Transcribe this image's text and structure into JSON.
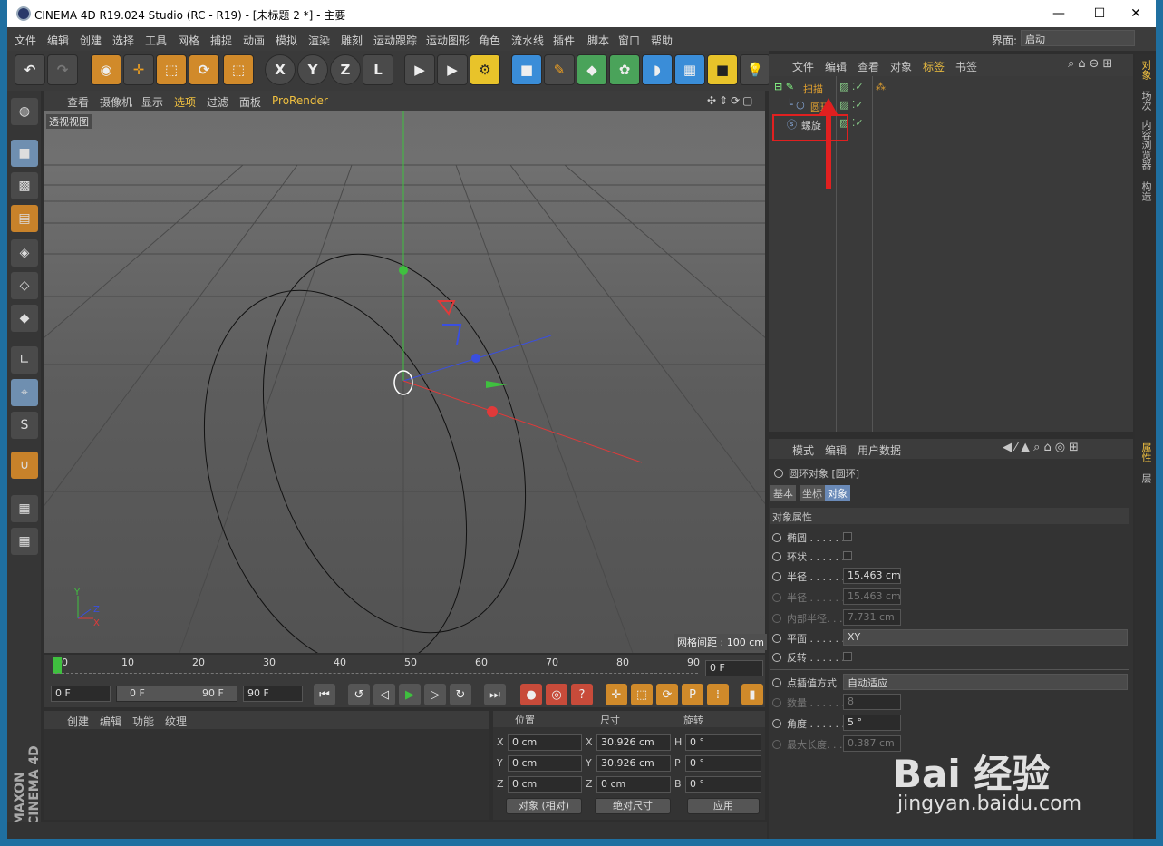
{
  "window": {
    "title": "CINEMA 4D R19.024 Studio (RC - R19) - [未标题 2 *] - 主要",
    "min": "—",
    "max": "☐",
    "close": "✕"
  },
  "menu": [
    "文件",
    "编辑",
    "创建",
    "选择",
    "工具",
    "网格",
    "捕捉",
    "动画",
    "模拟",
    "渲染",
    "雕刻",
    "运动跟踪",
    "运动图形",
    "角色",
    "流水线",
    "插件",
    "脚本",
    "窗口",
    "帮助"
  ],
  "layout": {
    "label": "界面:",
    "value": "启动"
  },
  "viewport_menu": [
    "查看",
    "摄像机",
    "显示",
    "选项",
    "过滤",
    "面板",
    "ProRender"
  ],
  "viewport": {
    "label": "透视视图",
    "grid_spacing": "网格间距 : 100 cm",
    "axis_y": "Y",
    "axis_z": "Z",
    "axis_x": "X"
  },
  "timeline": {
    "ticks": [
      "0",
      "10",
      "20",
      "30",
      "40",
      "50",
      "60",
      "70",
      "80",
      "90"
    ],
    "current_frame": "0 F"
  },
  "transport": {
    "start": "0 F",
    "range_start": "0 F",
    "range_end": "90 F",
    "end": "90 F"
  },
  "material_menu": [
    "创建",
    "编辑",
    "功能",
    "纹理"
  ],
  "coords": {
    "headers": [
      "位置",
      "尺寸",
      "旋转"
    ],
    "rows": [
      {
        "pl": "X",
        "pos": "0 cm",
        "sl": "X",
        "size": "30.926 cm",
        "rl": "H",
        "rot": "0 °"
      },
      {
        "pl": "Y",
        "pos": "0 cm",
        "sl": "Y",
        "size": "30.926 cm",
        "rl": "P",
        "rot": "0 °"
      },
      {
        "pl": "Z",
        "pos": "0 cm",
        "sl": "Z",
        "size": "0 cm",
        "rl": "B",
        "rot": "0 °"
      }
    ],
    "mode": "对象 (相对)",
    "size_mode": "绝对尺寸",
    "apply": "应用"
  },
  "object_manager": {
    "menu": [
      "文件",
      "编辑",
      "查看",
      "对象",
      "标签",
      "书签"
    ],
    "objects": [
      {
        "name": "扫描",
        "color": "#e0a030"
      },
      {
        "name": "圆环",
        "color": "#e0a030"
      },
      {
        "name": "螺旋",
        "color": "#c8c8c8"
      }
    ]
  },
  "attributes": {
    "menu": [
      "模式",
      "编辑",
      "用户数据"
    ],
    "title": "圆环对象 [圆环]",
    "tabs": [
      "基本",
      "坐标",
      "对象"
    ],
    "section": "对象属性",
    "rows": [
      {
        "label": "椭圆 . . . . . .",
        "type": "check"
      },
      {
        "label": "环状 . . . . . .",
        "type": "check"
      },
      {
        "label": "半径 . . . . . .",
        "value": "15.463 cm"
      },
      {
        "label": "半径 . . . . . .",
        "value": "15.463 cm",
        "dim": true
      },
      {
        "label": "内部半径. . .",
        "value": "7.731 cm",
        "dim": true
      },
      {
        "label": "平面 . . . . . .",
        "value": "XY",
        "wide": true
      },
      {
        "label": "反转 . . . . . .",
        "type": "check"
      },
      {
        "label": "点插值方式",
        "value": "自动适应",
        "wide": true
      },
      {
        "label": "数量 . . . . . .",
        "value": "8",
        "dim": true
      },
      {
        "label": "角度 . . . . . .",
        "value": "5 °"
      },
      {
        "label": "最大长度. . .",
        "value": "0.387 cm",
        "dim": true
      }
    ]
  },
  "right_tabs": [
    "对象",
    "场次",
    "内容浏览器",
    "构造",
    "属性",
    "层"
  ],
  "brand": "MAXON CINEMA 4D",
  "watermark": {
    "text": "Bai 经验",
    "url": "jingyan.baidu.com"
  },
  "colors": {
    "accent": "#e0a030",
    "highlight_box": "#e02020"
  }
}
